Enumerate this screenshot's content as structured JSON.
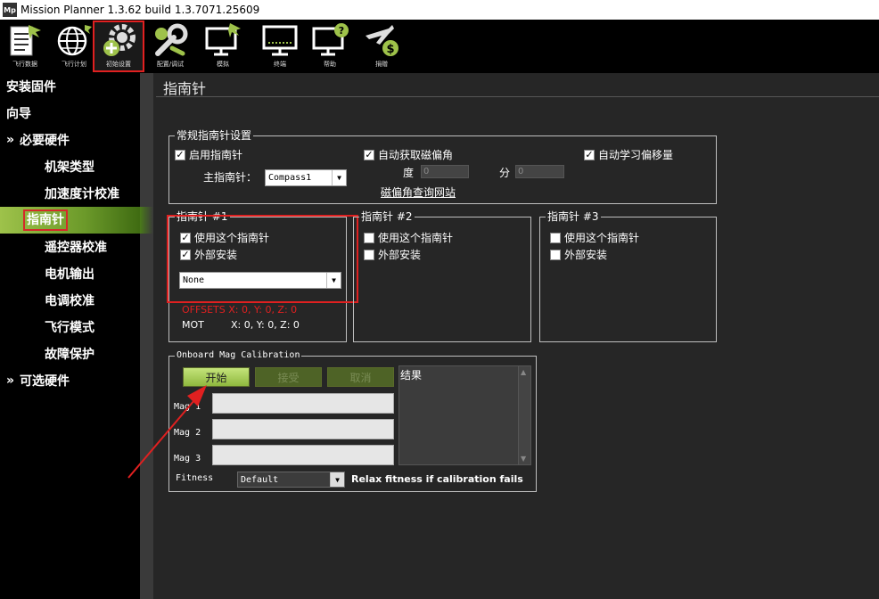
{
  "window": {
    "app_icon_text": "Mp",
    "title": "Mission Planner 1.3.62 build 1.3.7071.25609"
  },
  "toolbar": [
    {
      "label": "飞行数据",
      "icon": "flight-data-icon"
    },
    {
      "label": "飞行计划",
      "icon": "flight-plan-icon"
    },
    {
      "label": "初始设置",
      "icon": "initial-setup-icon",
      "selected": true
    },
    {
      "label": "配置/调试",
      "icon": "config-tuning-icon"
    },
    {
      "label": "模拟",
      "icon": "simulation-icon"
    },
    {
      "label": "终端",
      "icon": "terminal-icon"
    },
    {
      "label": "帮助",
      "icon": "help-icon"
    },
    {
      "label": "捐赠",
      "icon": "donate-icon"
    }
  ],
  "sidebar": {
    "items": [
      {
        "label": "安装固件"
      },
      {
        "label": "向导"
      },
      {
        "label": "必要硬件",
        "prefix": "»"
      },
      {
        "label": "机架类型"
      },
      {
        "label": "加速度计校准"
      },
      {
        "label": "指南针",
        "selected": true
      },
      {
        "label": "遥控器校准"
      },
      {
        "label": "电机输出"
      },
      {
        "label": "电调校准"
      },
      {
        "label": "飞行模式"
      },
      {
        "label": "故障保护"
      },
      {
        "label": "可选硬件",
        "prefix": "»"
      }
    ]
  },
  "page": {
    "title": "指南针"
  },
  "general": {
    "title": "常规指南针设置",
    "enable_compass": "启用指南针",
    "auto_declination": "自动获取磁偏角",
    "auto_learn_offsets": "自动学习偏移量",
    "primary_label": "主指南针：",
    "primary_value": "Compass1",
    "degrees_label": "度",
    "degrees_value": "0",
    "minutes_label": "分",
    "minutes_value": "0",
    "declination_link": "磁偏角查询网站"
  },
  "compass1": {
    "title": "指南针 #1",
    "use": "使用这个指南针",
    "external": "外部安装",
    "orientation": "None",
    "offsets": "OFFSETS  X: 0,   Y: 0,   Z: 0",
    "mot_label": "MOT",
    "mot_values": "X: 0,   Y: 0,   Z: 0"
  },
  "compass2": {
    "title": "指南针 #2",
    "use": "使用这个指南针",
    "external": "外部安装"
  },
  "compass3": {
    "title": "指南针 #3",
    "use": "使用这个指南针",
    "external": "外部安装"
  },
  "onboard": {
    "title": "Onboard Mag Calibration",
    "start": "开始",
    "accept": "接受",
    "cancel": "取消",
    "result_label": "结果",
    "mag1": "Mag 1",
    "mag2": "Mag 2",
    "mag3": "Mag 3",
    "fitness_label": "Fitness",
    "fitness_value": "Default",
    "relax": "Relax fitness if calibration fails"
  },
  "colors": {
    "accent_green": "#9ec24a",
    "highlight_red": "#e02020",
    "offsets_red": "#e02020"
  }
}
